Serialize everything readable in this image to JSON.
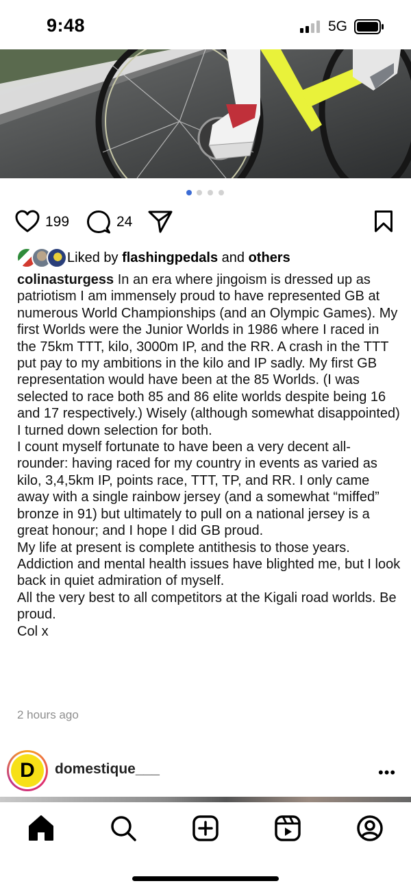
{
  "status": {
    "time": "9:48",
    "network": "5G"
  },
  "carousel": {
    "total": 4,
    "active_index": 0
  },
  "post": {
    "likes": "199",
    "comments": "24",
    "liked_by_prefix": "Liked by",
    "liked_by_user": "flashingpedals",
    "liked_by_and": "and",
    "liked_by_others": "others",
    "author": "colinasturgess",
    "caption_lines": [
      "In an era where jingoism is dressed up as patriotism I am immensely proud to have represented GB at numerous World Championships (and an Olympic Games). My first Worlds were the Junior Worlds in 1986 where I raced in the 75km TTT, kilo, 3000m IP, and the RR. A crash in the TTT put pay to my ambitions in the kilo and IP sadly. My first GB representation would have been at the 85 Worlds. (I was selected to race both 85 and 86 elite worlds despite being 16 and 17 respectively.) Wisely (although somewhat disappointed) I turned down selection for both.",
      "I count myself fortunate to have been a very decent all-rounder: having raced for my country in events as varied as kilo, 3,4,5km IP, points race, TTT, TP, and RR. I only came away with a single rainbow jersey (and a somewhat “miffed” bronze in 91) but ultimately to pull on a national jersey is a great honour; and I hope I did GB proud.",
      "My life at present is complete antithesis to those years. Addiction and mental health issues have blighted me, but I look back in quiet admiration of myself.",
      "All the very best to all competitors at the Kigali road worlds. Be proud.",
      "Col x"
    ],
    "timestamp": "2 hours ago"
  },
  "next_post": {
    "username": "domestique___",
    "avatar_letter": "D"
  },
  "tabs": [
    "home",
    "search",
    "create",
    "reels",
    "profile"
  ],
  "colors": {
    "carousel_active": "#3b6bd4",
    "bike_yellow": "#e9f23a"
  }
}
